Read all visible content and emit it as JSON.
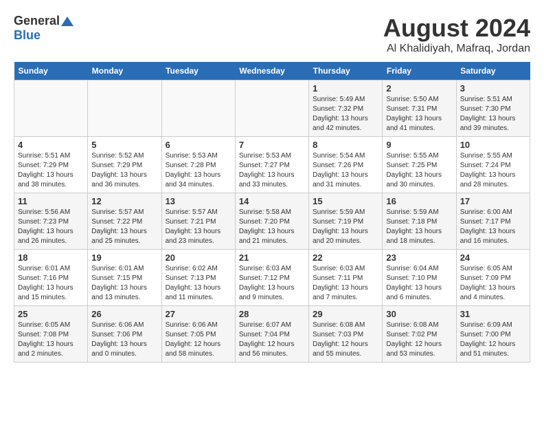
{
  "header": {
    "logo_general": "General",
    "logo_blue": "Blue",
    "title": "August 2024",
    "subtitle": "Al Khalidiyah, Mafraq, Jordan"
  },
  "weekdays": [
    "Sunday",
    "Monday",
    "Tuesday",
    "Wednesday",
    "Thursday",
    "Friday",
    "Saturday"
  ],
  "weeks": [
    [
      {
        "day": "",
        "sunrise": "",
        "sunset": "",
        "daylight": ""
      },
      {
        "day": "",
        "sunrise": "",
        "sunset": "",
        "daylight": ""
      },
      {
        "day": "",
        "sunrise": "",
        "sunset": "",
        "daylight": ""
      },
      {
        "day": "",
        "sunrise": "",
        "sunset": "",
        "daylight": ""
      },
      {
        "day": "1",
        "sunrise": "Sunrise: 5:49 AM",
        "sunset": "Sunset: 7:32 PM",
        "daylight": "Daylight: 13 hours and 42 minutes."
      },
      {
        "day": "2",
        "sunrise": "Sunrise: 5:50 AM",
        "sunset": "Sunset: 7:31 PM",
        "daylight": "Daylight: 13 hours and 41 minutes."
      },
      {
        "day": "3",
        "sunrise": "Sunrise: 5:51 AM",
        "sunset": "Sunset: 7:30 PM",
        "daylight": "Daylight: 13 hours and 39 minutes."
      }
    ],
    [
      {
        "day": "4",
        "sunrise": "Sunrise: 5:51 AM",
        "sunset": "Sunset: 7:29 PM",
        "daylight": "Daylight: 13 hours and 38 minutes."
      },
      {
        "day": "5",
        "sunrise": "Sunrise: 5:52 AM",
        "sunset": "Sunset: 7:29 PM",
        "daylight": "Daylight: 13 hours and 36 minutes."
      },
      {
        "day": "6",
        "sunrise": "Sunrise: 5:53 AM",
        "sunset": "Sunset: 7:28 PM",
        "daylight": "Daylight: 13 hours and 34 minutes."
      },
      {
        "day": "7",
        "sunrise": "Sunrise: 5:53 AM",
        "sunset": "Sunset: 7:27 PM",
        "daylight": "Daylight: 13 hours and 33 minutes."
      },
      {
        "day": "8",
        "sunrise": "Sunrise: 5:54 AM",
        "sunset": "Sunset: 7:26 PM",
        "daylight": "Daylight: 13 hours and 31 minutes."
      },
      {
        "day": "9",
        "sunrise": "Sunrise: 5:55 AM",
        "sunset": "Sunset: 7:25 PM",
        "daylight": "Daylight: 13 hours and 30 minutes."
      },
      {
        "day": "10",
        "sunrise": "Sunrise: 5:55 AM",
        "sunset": "Sunset: 7:24 PM",
        "daylight": "Daylight: 13 hours and 28 minutes."
      }
    ],
    [
      {
        "day": "11",
        "sunrise": "Sunrise: 5:56 AM",
        "sunset": "Sunset: 7:23 PM",
        "daylight": "Daylight: 13 hours and 26 minutes."
      },
      {
        "day": "12",
        "sunrise": "Sunrise: 5:57 AM",
        "sunset": "Sunset: 7:22 PM",
        "daylight": "Daylight: 13 hours and 25 minutes."
      },
      {
        "day": "13",
        "sunrise": "Sunrise: 5:57 AM",
        "sunset": "Sunset: 7:21 PM",
        "daylight": "Daylight: 13 hours and 23 minutes."
      },
      {
        "day": "14",
        "sunrise": "Sunrise: 5:58 AM",
        "sunset": "Sunset: 7:20 PM",
        "daylight": "Daylight: 13 hours and 21 minutes."
      },
      {
        "day": "15",
        "sunrise": "Sunrise: 5:59 AM",
        "sunset": "Sunset: 7:19 PM",
        "daylight": "Daylight: 13 hours and 20 minutes."
      },
      {
        "day": "16",
        "sunrise": "Sunrise: 5:59 AM",
        "sunset": "Sunset: 7:18 PM",
        "daylight": "Daylight: 13 hours and 18 minutes."
      },
      {
        "day": "17",
        "sunrise": "Sunrise: 6:00 AM",
        "sunset": "Sunset: 7:17 PM",
        "daylight": "Daylight: 13 hours and 16 minutes."
      }
    ],
    [
      {
        "day": "18",
        "sunrise": "Sunrise: 6:01 AM",
        "sunset": "Sunset: 7:16 PM",
        "daylight": "Daylight: 13 hours and 15 minutes."
      },
      {
        "day": "19",
        "sunrise": "Sunrise: 6:01 AM",
        "sunset": "Sunset: 7:15 PM",
        "daylight": "Daylight: 13 hours and 13 minutes."
      },
      {
        "day": "20",
        "sunrise": "Sunrise: 6:02 AM",
        "sunset": "Sunset: 7:13 PM",
        "daylight": "Daylight: 13 hours and 11 minutes."
      },
      {
        "day": "21",
        "sunrise": "Sunrise: 6:03 AM",
        "sunset": "Sunset: 7:12 PM",
        "daylight": "Daylight: 13 hours and 9 minutes."
      },
      {
        "day": "22",
        "sunrise": "Sunrise: 6:03 AM",
        "sunset": "Sunset: 7:11 PM",
        "daylight": "Daylight: 13 hours and 7 minutes."
      },
      {
        "day": "23",
        "sunrise": "Sunrise: 6:04 AM",
        "sunset": "Sunset: 7:10 PM",
        "daylight": "Daylight: 13 hours and 6 minutes."
      },
      {
        "day": "24",
        "sunrise": "Sunrise: 6:05 AM",
        "sunset": "Sunset: 7:09 PM",
        "daylight": "Daylight: 13 hours and 4 minutes."
      }
    ],
    [
      {
        "day": "25",
        "sunrise": "Sunrise: 6:05 AM",
        "sunset": "Sunset: 7:08 PM",
        "daylight": "Daylight: 13 hours and 2 minutes."
      },
      {
        "day": "26",
        "sunrise": "Sunrise: 6:06 AM",
        "sunset": "Sunset: 7:06 PM",
        "daylight": "Daylight: 13 hours and 0 minutes."
      },
      {
        "day": "27",
        "sunrise": "Sunrise: 6:06 AM",
        "sunset": "Sunset: 7:05 PM",
        "daylight": "Daylight: 12 hours and 58 minutes."
      },
      {
        "day": "28",
        "sunrise": "Sunrise: 6:07 AM",
        "sunset": "Sunset: 7:04 PM",
        "daylight": "Daylight: 12 hours and 56 minutes."
      },
      {
        "day": "29",
        "sunrise": "Sunrise: 6:08 AM",
        "sunset": "Sunset: 7:03 PM",
        "daylight": "Daylight: 12 hours and 55 minutes."
      },
      {
        "day": "30",
        "sunrise": "Sunrise: 6:08 AM",
        "sunset": "Sunset: 7:02 PM",
        "daylight": "Daylight: 12 hours and 53 minutes."
      },
      {
        "day": "31",
        "sunrise": "Sunrise: 6:09 AM",
        "sunset": "Sunset: 7:00 PM",
        "daylight": "Daylight: 12 hours and 51 minutes."
      }
    ]
  ]
}
